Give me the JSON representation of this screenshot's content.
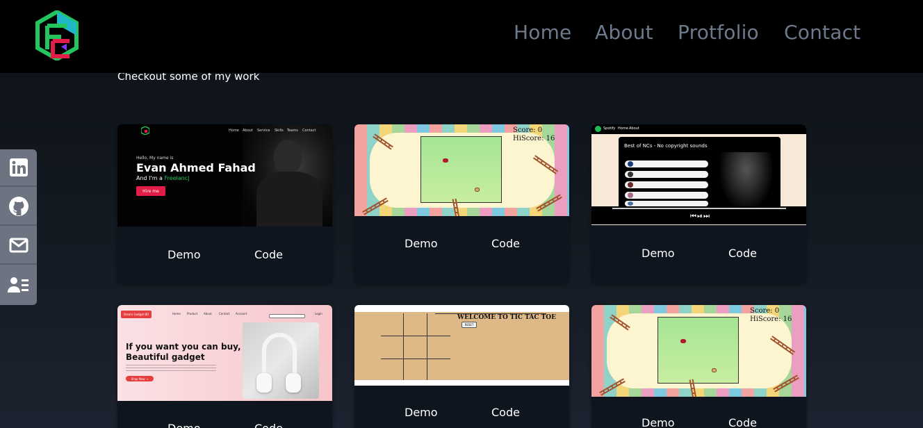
{
  "header": {
    "logo_label": "FE",
    "nav": [
      "Home",
      "About",
      "Protfolio",
      "Contact"
    ]
  },
  "intro": "Checkout some of my work",
  "social": [
    "linkedin-icon",
    "github-icon",
    "mail-icon",
    "contact-card-icon"
  ],
  "cards": [
    {
      "demo_label": "Demo",
      "code_label": "Code",
      "thumb": {
        "nav": [
          "Home",
          "About",
          "Service",
          "Skills",
          "Teams",
          "Contact"
        ],
        "hello": "Hello, My name is",
        "name": "Evan Ahmed Fahad",
        "role_prefix": "And I'm a",
        "role_highlight": "Freelanc|",
        "button": "Hire me"
      }
    },
    {
      "demo_label": "Demo",
      "code_label": "Code",
      "thumb": {
        "score": "Score: 0",
        "hiscore": "HiScore: 16"
      }
    },
    {
      "demo_label": "Demo",
      "code_label": "Code",
      "thumb": {
        "brand": "Spotify",
        "nav": [
          "Home",
          "About"
        ],
        "title": "Best of NCs - No copyright sounds",
        "controls": "⏮⏯⏭"
      }
    },
    {
      "demo_label": "Demo",
      "code_label": "Code",
      "thumb": {
        "brand": "Dream Gadget BD",
        "nav": [
          "Home",
          "Product",
          "About",
          "Contact",
          "Account"
        ],
        "headline_1": "If you want you can buy,",
        "headline_2": "Beautiful gadget",
        "button": "Shop Now →",
        "login": "Login"
      }
    },
    {
      "demo_label": "Demo",
      "code_label": "Code",
      "thumb": {
        "title": "WELCOME TO TIC TAC TOE",
        "reset": "RESET"
      }
    },
    {
      "demo_label": "Demo",
      "code_label": "Code",
      "thumb": {
        "score": "Score: 0",
        "hiscore": "HiScore: 16"
      }
    }
  ],
  "colors": {
    "nav_link": "#6d7a8c",
    "accent_green": "#22c55e",
    "accent_red": "#e11d48",
    "social_bg": "#6d7381"
  }
}
